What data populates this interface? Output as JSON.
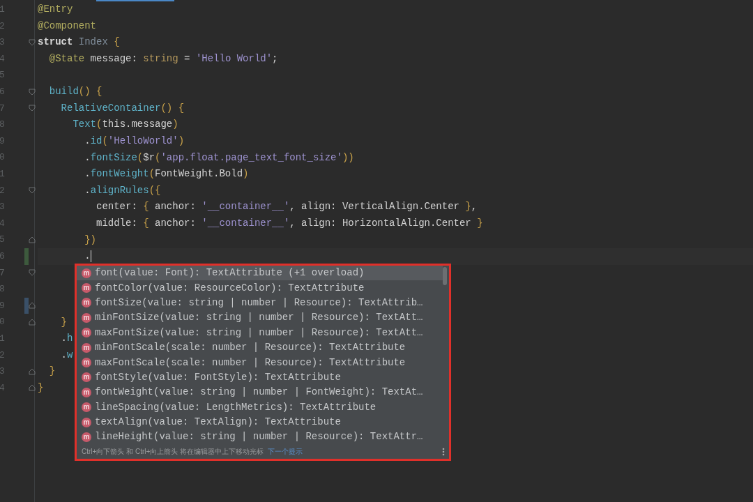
{
  "editor": {
    "lines": [
      {
        "number": "1",
        "fold_start": false,
        "fold_end": false,
        "tokens": [
          {
            "kind": "anno",
            "text": "@Entry"
          }
        ]
      },
      {
        "number": "2",
        "fold_start": false,
        "fold_end": false,
        "tokens": [
          {
            "kind": "anno",
            "text": "@Component"
          }
        ]
      },
      {
        "number": "3",
        "fold_start": true,
        "fold_end": false,
        "tokens": [
          {
            "kind": "kw",
            "text": "struct "
          },
          {
            "kind": "cls",
            "text": "Index "
          },
          {
            "kind": "punct",
            "text": "{"
          }
        ]
      },
      {
        "number": "4",
        "fold_start": false,
        "fold_end": false,
        "tokens": [
          {
            "kind": "anno",
            "text": "  @State"
          },
          {
            "kind": "plain",
            "text": " message: "
          },
          {
            "kind": "type",
            "text": "string"
          },
          {
            "kind": "plain",
            "text": " = "
          },
          {
            "kind": "str",
            "text": "'Hello World'"
          },
          {
            "kind": "plain",
            "text": ";"
          }
        ]
      },
      {
        "number": "5",
        "fold_start": false,
        "fold_end": false
      },
      {
        "number": "6",
        "fold_start": true,
        "fold_end": false,
        "tokens": [
          {
            "kind": "fn",
            "text": "  build"
          },
          {
            "kind": "punct",
            "text": "() {"
          }
        ]
      },
      {
        "number": "7",
        "fold_start": true,
        "fold_end": false,
        "tokens": [
          {
            "kind": "fn",
            "text": "    RelativeContainer"
          },
          {
            "kind": "punct",
            "text": "() {"
          }
        ]
      },
      {
        "number": "8",
        "fold_start": false,
        "fold_end": false,
        "tokens": [
          {
            "kind": "fn",
            "text": "      Text"
          },
          {
            "kind": "punct",
            "text": "("
          },
          {
            "kind": "plain",
            "text": "this.message"
          },
          {
            "kind": "punct",
            "text": ")"
          }
        ]
      },
      {
        "number": "9",
        "fold_start": false,
        "fold_end": false,
        "tokens": [
          {
            "kind": "plain",
            "text": "        ."
          },
          {
            "kind": "fn",
            "text": "id"
          },
          {
            "kind": "punct",
            "text": "("
          },
          {
            "kind": "str",
            "text": "'HelloWorld'"
          },
          {
            "kind": "punct",
            "text": ")"
          }
        ]
      },
      {
        "number": "0",
        "fold_start": false,
        "fold_end": false,
        "tokens": [
          {
            "kind": "plain",
            "text": "        ."
          },
          {
            "kind": "fn",
            "text": "fontSize"
          },
          {
            "kind": "punct",
            "text": "("
          },
          {
            "kind": "plain",
            "text": "$r"
          },
          {
            "kind": "punct",
            "text": "("
          },
          {
            "kind": "str",
            "text": "'app.float.page_text_font_size'"
          },
          {
            "kind": "punct",
            "text": "))"
          }
        ]
      },
      {
        "number": "1",
        "fold_start": false,
        "fold_end": false,
        "tokens": [
          {
            "kind": "plain",
            "text": "        ."
          },
          {
            "kind": "fn",
            "text": "fontWeight"
          },
          {
            "kind": "punct",
            "text": "("
          },
          {
            "kind": "plain",
            "text": "FontWeight.Bold"
          },
          {
            "kind": "punct",
            "text": ")"
          }
        ]
      },
      {
        "number": "2",
        "fold_start": true,
        "fold_end": false,
        "tokens": [
          {
            "kind": "plain",
            "text": "        ."
          },
          {
            "kind": "fn",
            "text": "alignRules"
          },
          {
            "kind": "punct",
            "text": "({"
          }
        ]
      },
      {
        "number": "3",
        "fold_start": false,
        "fold_end": false,
        "tokens": [
          {
            "kind": "plain",
            "text": "          center: "
          },
          {
            "kind": "punct",
            "text": "{"
          },
          {
            "kind": "plain",
            "text": " anchor: "
          },
          {
            "kind": "str",
            "text": "'__container__'"
          },
          {
            "kind": "plain",
            "text": ", align: VerticalAlign.Center "
          },
          {
            "kind": "punct",
            "text": "}"
          },
          {
            "kind": "plain",
            "text": ","
          }
        ]
      },
      {
        "number": "4",
        "fold_start": false,
        "fold_end": false,
        "tokens": [
          {
            "kind": "plain",
            "text": "          middle: "
          },
          {
            "kind": "punct",
            "text": "{"
          },
          {
            "kind": "plain",
            "text": " anchor: "
          },
          {
            "kind": "str",
            "text": "'__container__'"
          },
          {
            "kind": "plain",
            "text": ", align: HorizontalAlign.Center "
          },
          {
            "kind": "punct",
            "text": "}"
          }
        ]
      },
      {
        "number": "5",
        "fold_start": false,
        "fold_end": true,
        "tokens": [
          {
            "kind": "punct",
            "text": "        })"
          }
        ]
      },
      {
        "number": "6",
        "fold_start": false,
        "fold_end": false,
        "current": true,
        "color": "#3d5a3d",
        "tokens": [
          {
            "kind": "plain",
            "text": "        ."
          }
        ]
      },
      {
        "number": "7",
        "fold_start": true,
        "fold_end": false
      },
      {
        "number": "8",
        "fold_start": false,
        "fold_end": false
      },
      {
        "number": "9",
        "fold_start": false,
        "fold_end": true,
        "color": "#3a5068"
      },
      {
        "number": "0",
        "fold_start": false,
        "fold_end": true,
        "tokens": [
          {
            "kind": "punct",
            "text": "    }"
          }
        ]
      },
      {
        "number": "1",
        "fold_start": false,
        "fold_end": false,
        "tokens": [
          {
            "kind": "plain",
            "text": "    ."
          },
          {
            "kind": "fn",
            "text": "h"
          }
        ]
      },
      {
        "number": "2",
        "fold_start": false,
        "fold_end": false,
        "tokens": [
          {
            "kind": "plain",
            "text": "    ."
          },
          {
            "kind": "fn",
            "text": "w"
          }
        ]
      },
      {
        "number": "3",
        "fold_start": false,
        "fold_end": true,
        "tokens": [
          {
            "kind": "punct",
            "text": "  }"
          }
        ]
      },
      {
        "number": "4",
        "fold_start": false,
        "fold_end": true,
        "tokens": [
          {
            "kind": "punct",
            "text": "}"
          }
        ]
      }
    ]
  },
  "completion": {
    "items": [
      {
        "icon": "m",
        "text": "font(value: Font): TextAttribute (+1 overload)",
        "selected": true
      },
      {
        "icon": "m",
        "text": "fontColor(value: ResourceColor): TextAttribute",
        "selected": false
      },
      {
        "icon": "m",
        "text": "fontSize(value: string | number | Resource): TextAttrib…",
        "selected": false
      },
      {
        "icon": "m",
        "text": "minFontSize(value: string | number | Resource): TextAtt…",
        "selected": false
      },
      {
        "icon": "m",
        "text": "maxFontSize(value: string | number | Resource): TextAtt…",
        "selected": false
      },
      {
        "icon": "m",
        "text": "minFontScale(scale: number | Resource): TextAttribute",
        "selected": false
      },
      {
        "icon": "m",
        "text": "maxFontScale(scale: number | Resource): TextAttribute",
        "selected": false
      },
      {
        "icon": "m",
        "text": "fontStyle(value: FontStyle): TextAttribute",
        "selected": false
      },
      {
        "icon": "m",
        "text": "fontWeight(value: string | number | FontWeight): TextAt…",
        "selected": false
      },
      {
        "icon": "m",
        "text": "lineSpacing(value: LengthMetrics): TextAttribute",
        "selected": false
      },
      {
        "icon": "m",
        "text": "textAlign(value: TextAlign): TextAttribute",
        "selected": false
      },
      {
        "icon": "m",
        "text": "lineHeight(value: string | number | Resource): TextAttr…",
        "selected": false
      }
    ],
    "hint": "Ctrl+向下箭头 和 Ctrl+向上箭头 将在编辑器中上下移动光标",
    "hint_link": "下一个提示"
  }
}
